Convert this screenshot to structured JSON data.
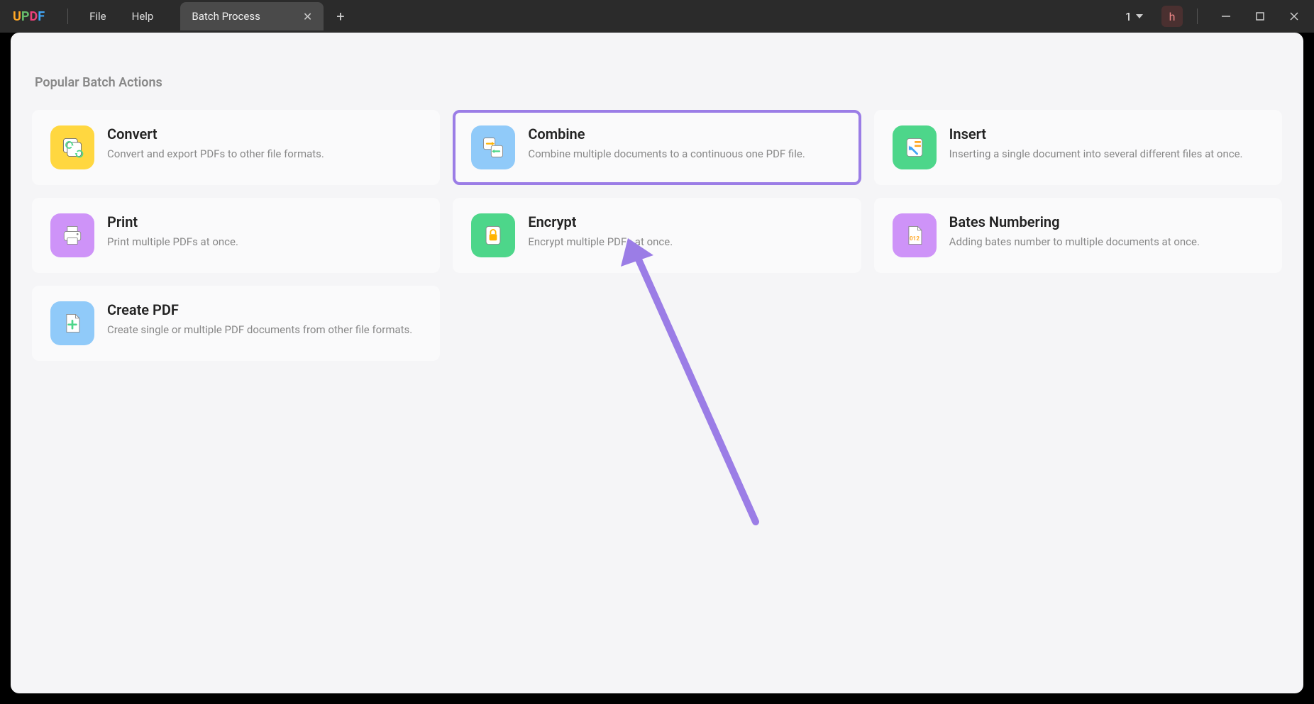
{
  "titleBar": {
    "menu": {
      "file": "File",
      "help": "Help"
    },
    "tab": {
      "label": "Batch Process"
    },
    "counter": "1",
    "user": "h"
  },
  "sectionTitle": "Popular Batch Actions",
  "cards": {
    "convert": {
      "title": "Convert",
      "desc": "Convert and export PDFs to other file formats."
    },
    "combine": {
      "title": "Combine",
      "desc": "Combine multiple documents to a continuous one PDF file."
    },
    "insert": {
      "title": "Insert",
      "desc": "Inserting a single document into several different files at once."
    },
    "print": {
      "title": "Print",
      "desc": "Print multiple PDFs at once."
    },
    "encrypt": {
      "title": "Encrypt",
      "desc": "Encrypt multiple PDFs at once."
    },
    "bates": {
      "title": "Bates Numbering",
      "desc": "Adding bates number to multiple documents at once."
    },
    "create": {
      "title": "Create PDF",
      "desc": "Create single or multiple PDF documents from other file formats."
    }
  }
}
